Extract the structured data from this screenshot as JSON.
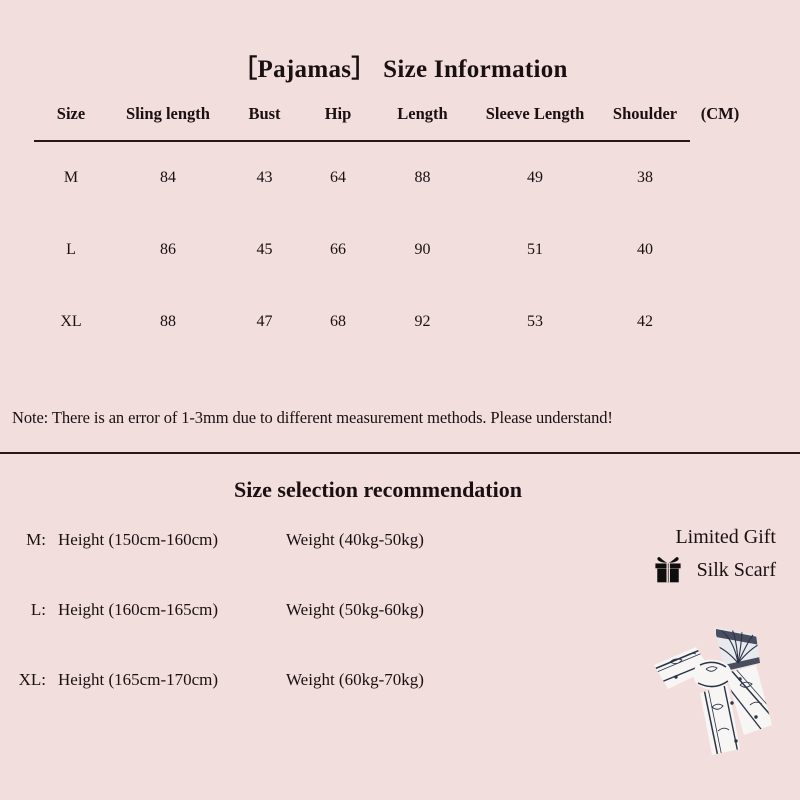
{
  "page": {
    "background_color": "#f2dedd",
    "text_color": "#1a1012",
    "rule_color": "#2a1518"
  },
  "top": {
    "title": "［Pajamas］ Size Information",
    "table": {
      "headers": [
        "Size",
        "Sling length",
        "Bust",
        "Hip",
        "Length",
        "Sleeve Length",
        "Shoulder",
        "(CM)"
      ],
      "rows": [
        {
          "size": "M",
          "sling_length": "84",
          "bust": "43",
          "hip": "64",
          "length": "88",
          "sleeve_length": "49",
          "shoulder": "38",
          "cm": ""
        },
        {
          "size": "L",
          "sling_length": "86",
          "bust": "45",
          "hip": "66",
          "length": "90",
          "sleeve_length": "51",
          "shoulder": "40",
          "cm": ""
        },
        {
          "size": "XL",
          "sling_length": "88",
          "bust": "47",
          "hip": "68",
          "length": "92",
          "sleeve_length": "53",
          "shoulder": "42",
          "cm": ""
        }
      ]
    },
    "note": "Note: There is an error of 1-3mm due to different measurement methods. Please understand!"
  },
  "bottom": {
    "title": "Size selection recommendation",
    "recommendations": [
      {
        "size": "M:",
        "height": "Height (150cm-160cm)",
        "weight": "Weight (40kg-50kg)"
      },
      {
        "size": "L:",
        "height": "Height (160cm-165cm)",
        "weight": "Weight (50kg-60kg)"
      },
      {
        "size": "XL:",
        "height": "Height (165cm-170cm)",
        "weight": "Weight (60kg-70kg)"
      }
    ],
    "gift": {
      "line1": "Limited Gift",
      "line2": "Silk Scarf",
      "icon": "gift-box-icon",
      "product_image": "silk-scarf-bow-image",
      "scarf_base_color": "#f6f5f3",
      "scarf_pattern_color": "#2b3347"
    }
  }
}
